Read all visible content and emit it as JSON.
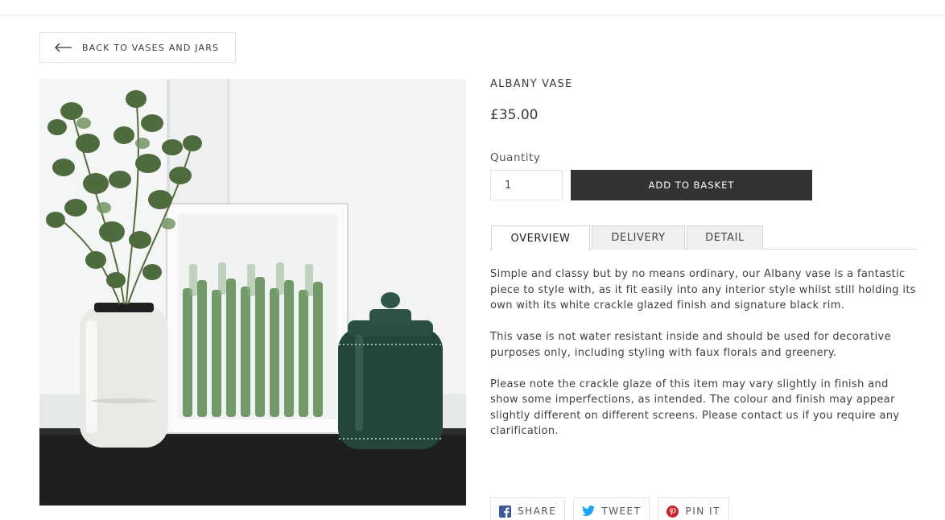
{
  "back_link": {
    "label": "BACK TO VASES AND JARS",
    "icon": "left-arrow-icon"
  },
  "product": {
    "image_alt": "Albany Vase",
    "title": "ALBANY VASE",
    "price": "£35.00"
  },
  "quantity": {
    "label": "Quantity",
    "value": "1"
  },
  "add_button": {
    "label": "ADD TO BASKET"
  },
  "tabs": [
    {
      "label": "OVERVIEW",
      "active": true
    },
    {
      "label": "DELIVERY",
      "active": false
    },
    {
      "label": "DETAIL",
      "active": false
    }
  ],
  "description": [
    "Simple and classy but by no means ordinary, our Albany vase is a fantastic piece to style with, as it fit easily into any interior style whilst still holding its own with its white crackle glazed finish and signature black rim.",
    "This vase is not water resistant inside and should be used for decorative purposes only, including styling with faux florals and greenery.",
    "Please note the crackle glaze of this item may vary slightly in finish and show some imperfections, as intended. The colour and finish may appear slightly different on different screens. Please contact us if you require any clarification."
  ],
  "share": [
    {
      "label": "SHARE",
      "icon": "facebook-icon",
      "color": "#3b5998"
    },
    {
      "label": "TWEET",
      "icon": "twitter-icon",
      "color": "#1da1f2"
    },
    {
      "label": "PIN IT",
      "icon": "pinterest-icon",
      "color": "#cb2027"
    }
  ]
}
